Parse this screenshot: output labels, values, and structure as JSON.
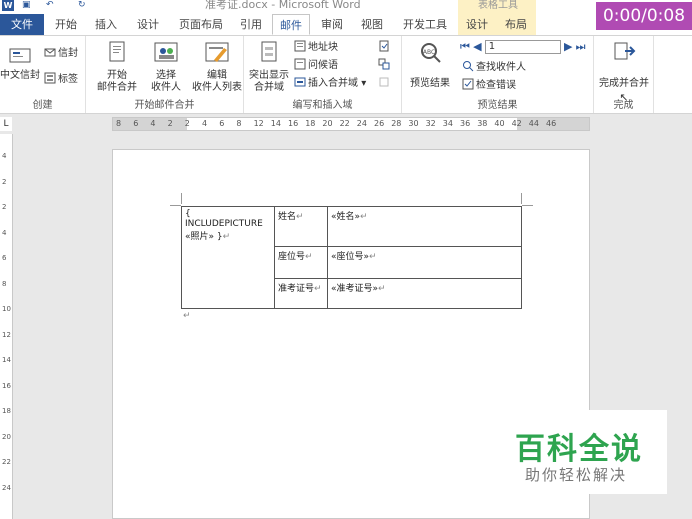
{
  "title_bar": {
    "document_title": "准考证.docx - Microsoft Word",
    "context_group": "表格工具"
  },
  "timer": "0:00/0:08",
  "tabs": [
    "文件",
    "开始",
    "插入",
    "设计",
    "页面布局",
    "引用",
    "邮件",
    "审阅",
    "视图",
    "开发工具",
    "设计",
    "布局"
  ],
  "active_tab": "邮件",
  "ribbon": {
    "create": {
      "label": "创建",
      "envelopes": "信封",
      "labels": "标签",
      "chinese_envelope": "中文信封"
    },
    "start_merge": {
      "label": "开始邮件合并",
      "start_line1": "开始",
      "start_line2": "邮件合并",
      "select_line1": "选择",
      "select_line2": "收件人",
      "edit_line1": "编辑",
      "edit_line2": "收件人列表"
    },
    "write_insert": {
      "label": "编写和插入域",
      "highlight_line1": "突出显示",
      "highlight_line2": "合并域",
      "address_block": "地址块",
      "greeting_line": "问候语",
      "insert_merge_field": "插入合并域"
    },
    "preview": {
      "label": "预览结果",
      "preview_results": "预览结果",
      "record_value": "1",
      "find_recipient": "查找收件人",
      "check_errors": "检查错误"
    },
    "finish": {
      "label": "完成",
      "finish_merge": "完成并合并"
    }
  },
  "ruler_ticks": [
    "8",
    "6",
    "4",
    "2",
    "2",
    "4",
    "6",
    "8",
    "12",
    "14",
    "16",
    "18",
    "20",
    "22",
    "24",
    "26",
    "28",
    "30",
    "32",
    "34",
    "36",
    "38",
    "40",
    "42",
    "44",
    "46"
  ],
  "vertical_ruler_ticks": [
    "4",
    "2",
    "2",
    "4",
    "6",
    "8",
    "10",
    "12",
    "14",
    "16",
    "18",
    "20",
    "22",
    "24"
  ],
  "ruler_corner": "L",
  "document": {
    "photo_field": "{ INCLUDEPICTURE «照片» }",
    "rows": [
      {
        "label": "姓名",
        "field": "«姓名»"
      },
      {
        "label": "座位号",
        "field": "«座位号»"
      },
      {
        "label": "准考证号",
        "field": "«准考证号»"
      }
    ],
    "para_mark": "↵"
  },
  "watermark": {
    "title": "百科全说",
    "subtitle": "助你轻松解决"
  },
  "colors": {
    "word_blue": "#2b579a",
    "context_yellow": "#fdf1c5",
    "timer_purple": "#b04bb3",
    "watermark_green": "#2ea44f"
  }
}
